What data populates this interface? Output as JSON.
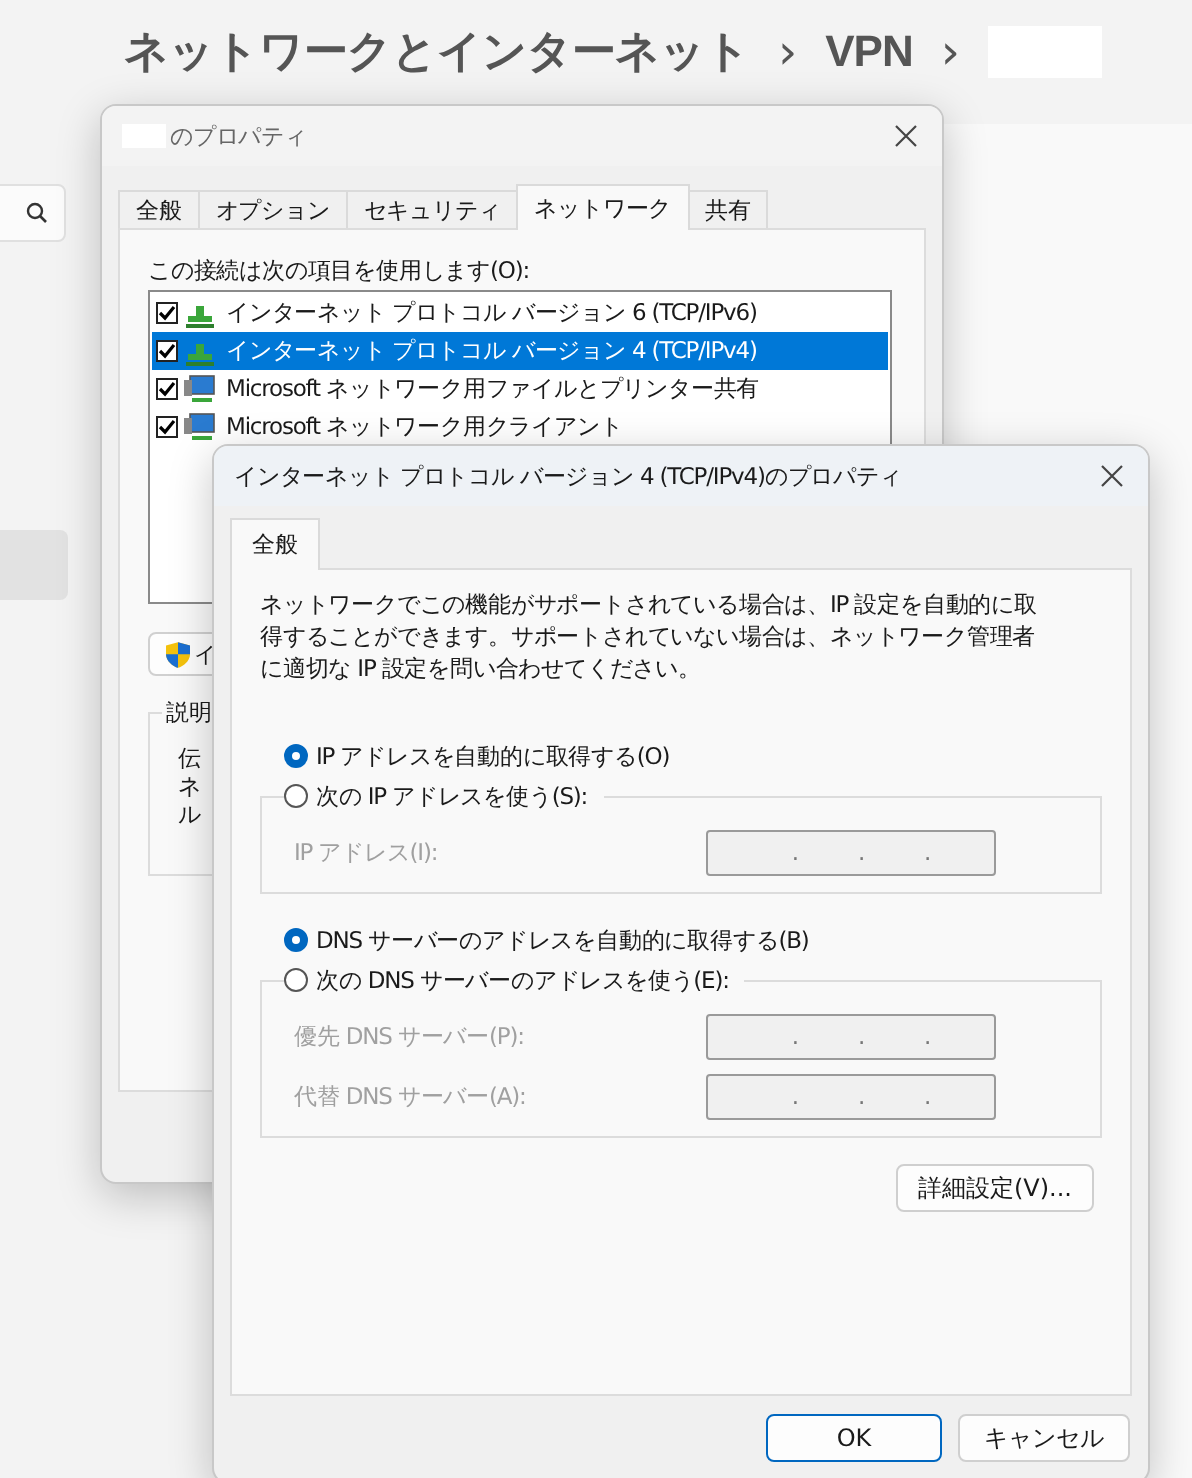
{
  "breadcrumb": [
    {
      "kind": "link",
      "label": "ネットワークとインターネット"
    },
    {
      "kind": "separator",
      "label": "›"
    },
    {
      "kind": "link",
      "label": "VPN"
    },
    {
      "kind": "separator",
      "label": "›"
    },
    {
      "kind": "redacted"
    }
  ],
  "sidebar": {
    "items": [
      {
        "selected": true
      }
    ]
  },
  "properties_dialog": {
    "title": "のプロパティ",
    "title_redacted": true,
    "tabs": [
      {
        "label": "全般",
        "selected": false
      },
      {
        "label": "オプション",
        "selected": false
      },
      {
        "label": "セキュリティ",
        "selected": false
      },
      {
        "label": "ネットワーク",
        "selected": true
      },
      {
        "label": "共有",
        "selected": false
      }
    ],
    "items_label": "この接続は次の項目を使用します(O):",
    "items": [
      {
        "kind": "protocol",
        "label": "インターネット プロトコル バージョン 6 (TCP/IPv6)",
        "checked": true,
        "selected": false
      },
      {
        "kind": "protocol",
        "label": "インターネット プロトコル バージョン 4 (TCP/IPv4)",
        "checked": true,
        "selected": true
      },
      {
        "kind": "service",
        "label": "Microsoft ネットワーク用ファイルとプリンター共有",
        "checked": true,
        "selected": false
      },
      {
        "kind": "service",
        "label": "Microsoft ネットワーク用クライアント",
        "checked": true,
        "selected": false
      }
    ],
    "install_button": "イ",
    "description_group": {
      "legend": "説明",
      "lines": [
        "伝",
        "ネ",
        "ル"
      ]
    }
  },
  "ipv4_dialog": {
    "title": "インターネット プロトコル バージョン 4 (TCP/IPv4)のプロパティ",
    "tabs": [
      {
        "label": "全般",
        "selected": true
      }
    ],
    "description": "ネットワークでこの機能がサポートされている場合は、IP 設定を自動的に取得することができます。サポートされていない場合は、ネットワーク管理者に適切な IP 設定を問い合わせてください。",
    "sections": [
      {
        "auto_option": {
          "label": "IP アドレスを自動的に取得する(O)",
          "selected": true
        },
        "manual_option": {
          "label": "次の IP アドレスを使う(S):",
          "selected": false
        },
        "disabled": true,
        "fields": [
          {
            "label": "IP アドレス(I):",
            "dots": [
              ".",
              ".",
              "."
            ]
          }
        ]
      },
      {
        "auto_option": {
          "label": "DNS サーバーのアドレスを自動的に取得する(B)",
          "selected": true
        },
        "manual_option": {
          "label": "次の DNS サーバーのアドレスを使う(E):",
          "selected": false
        },
        "disabled": true,
        "fields": [
          {
            "label": "優先 DNS サーバー(P):",
            "dots": [
              ".",
              ".",
              "."
            ]
          },
          {
            "label": "代替 DNS サーバー(A):",
            "dots": [
              ".",
              ".",
              "."
            ]
          }
        ]
      }
    ],
    "advanced_button": "詳細設定(V)...",
    "buttons": [
      {
        "kind": "default",
        "label": "OK"
      },
      {
        "kind": "normal",
        "label": "キャンセル"
      }
    ]
  }
}
